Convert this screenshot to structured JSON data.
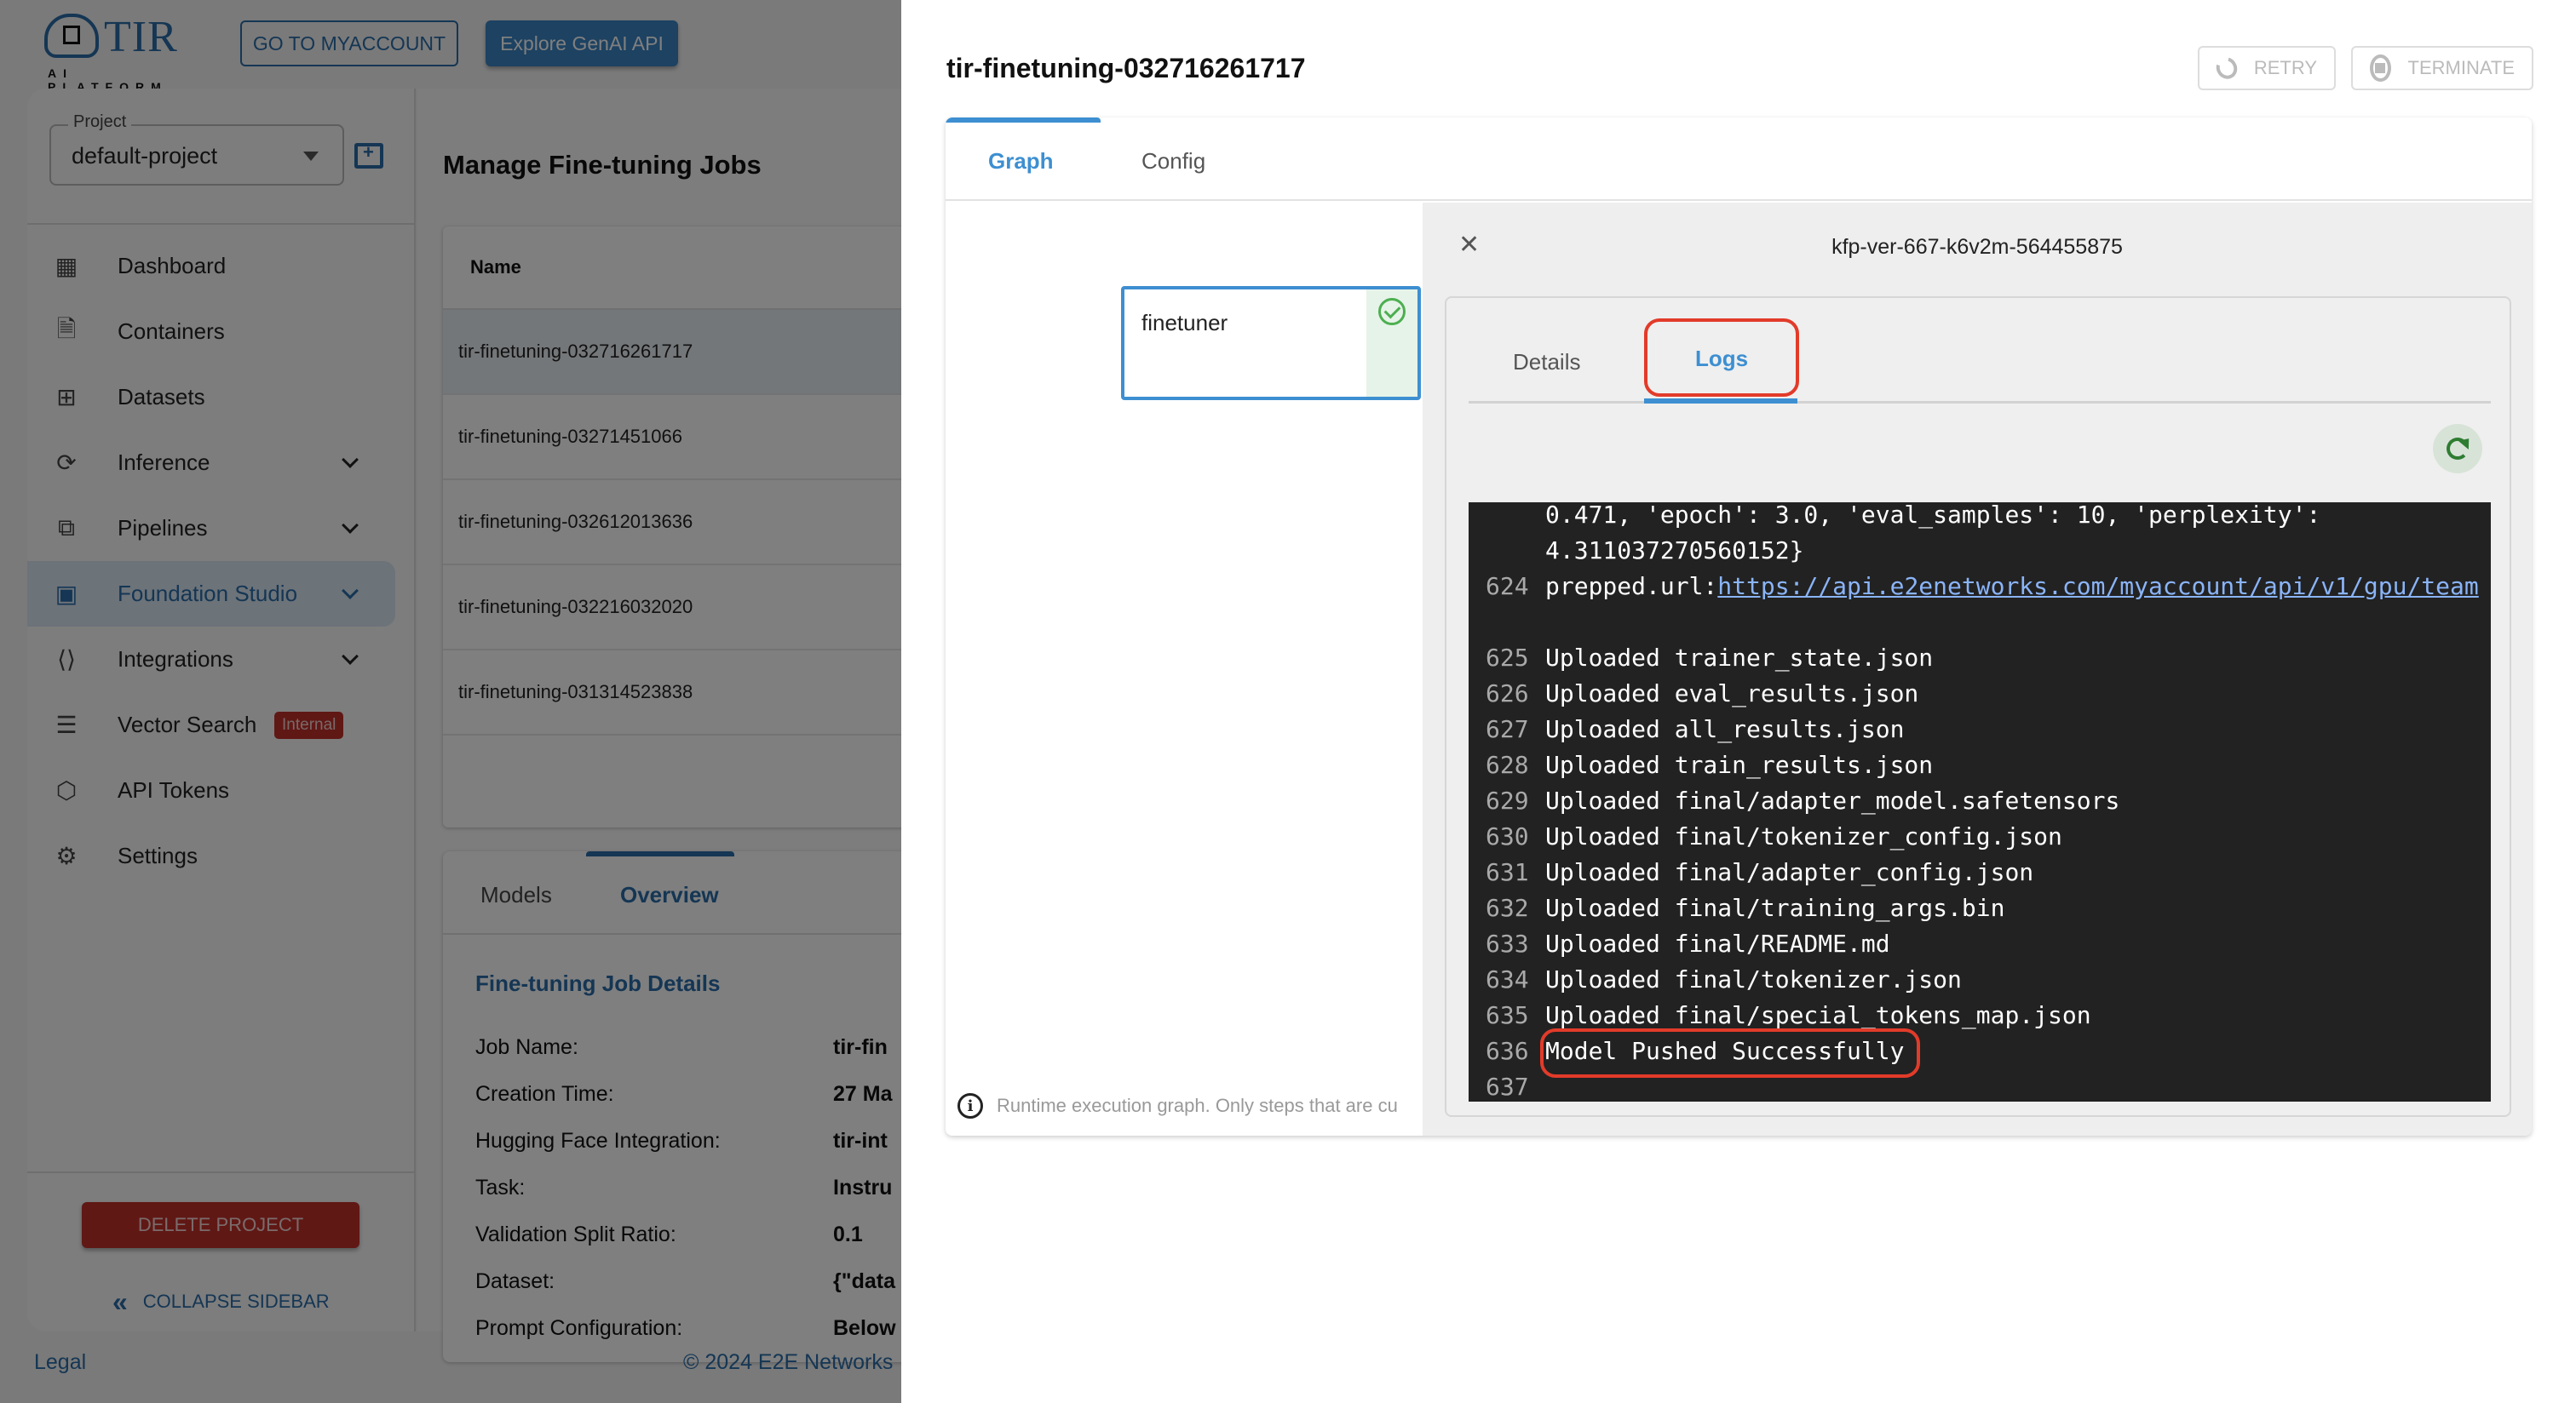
{
  "topbar": {
    "logo_text": "TIR",
    "logo_subtext": "AI PLATFORM",
    "myaccount_button": "GO TO MYACCOUNT",
    "genai_button": "Explore GenAI API"
  },
  "sidebar": {
    "project_label": "Project",
    "project_value": "default-project",
    "items": [
      {
        "label": "Dashboard",
        "icon": "dashboard-icon",
        "expandable": false
      },
      {
        "label": "Containers",
        "icon": "document-icon",
        "expandable": false
      },
      {
        "label": "Datasets",
        "icon": "grid-icon",
        "expandable": false
      },
      {
        "label": "Inference",
        "icon": "inference-icon",
        "expandable": true
      },
      {
        "label": "Pipelines",
        "icon": "pipeline-icon",
        "expandable": true
      },
      {
        "label": "Foundation Studio",
        "icon": "foundation-studio-icon",
        "expandable": true,
        "active": true
      },
      {
        "label": "Integrations",
        "icon": "integrations-icon",
        "expandable": true
      },
      {
        "label": "Vector Search",
        "icon": "vector-search-icon",
        "expandable": false,
        "badge": "Internal"
      },
      {
        "label": "API Tokens",
        "icon": "token-icon",
        "expandable": false
      },
      {
        "label": "Settings",
        "icon": "gear-icon",
        "expandable": false
      }
    ],
    "delete_project": "DELETE PROJECT",
    "collapse_sidebar": "COLLAPSE SIDEBAR"
  },
  "main": {
    "title": "Manage Fine-tuning Jobs",
    "table": {
      "columns": [
        "Name"
      ],
      "rows": [
        "tir-finetuning-032716261717",
        "tir-finetuning-03271451066",
        "tir-finetuning-032612013636",
        "tir-finetuning-032216032020",
        "tir-finetuning-031314523838"
      ]
    },
    "detail_tabs": [
      "Models",
      "Overview"
    ],
    "detail_heading": "Fine-tuning Job Details",
    "details": [
      {
        "label": "Job Name:",
        "value": "tir-fin"
      },
      {
        "label": "Creation Time:",
        "value": "27 Ma"
      },
      {
        "label": "Hugging Face Integration:",
        "value": "tir-int"
      },
      {
        "label": "Task:",
        "value": "Instru"
      },
      {
        "label": "Validation Split Ratio:",
        "value": "0.1"
      },
      {
        "label": "Dataset:",
        "value": "{\"data"
      },
      {
        "label": "Prompt Configuration:",
        "value": "Below"
      }
    ]
  },
  "footer": {
    "legal": "Legal",
    "copyright": "© 2024 E2E Networks"
  },
  "drawer": {
    "title": "tir-finetuning-032716261717",
    "retry": "RETRY",
    "terminate": "TERMINATE",
    "tabs": [
      "Graph",
      "Config"
    ],
    "graph": {
      "node_name": "finetuner",
      "node_status": "succeeded",
      "note": "Runtime execution graph. Only steps that are cu"
    },
    "panel": {
      "title": "kfp-ver-667-k6v2m-564455875",
      "tabs": [
        "Details",
        "Logs"
      ],
      "log_lines": [
        {
          "n": "",
          "text": "0.471, 'epoch': 3.0, 'eval_samples': 10, 'perplexity':"
        },
        {
          "n": "",
          "text": "4.311037270560152}"
        },
        {
          "n": "624",
          "text": "prepped.url:",
          "link": "https://api.e2enetworks.com/myaccount/api/v1/gpu/team"
        },
        {
          "n": "",
          "text": ""
        },
        {
          "n": "625",
          "text": "Uploaded trainer_state.json"
        },
        {
          "n": "626",
          "text": "Uploaded eval_results.json"
        },
        {
          "n": "627",
          "text": "Uploaded all_results.json"
        },
        {
          "n": "628",
          "text": "Uploaded train_results.json"
        },
        {
          "n": "629",
          "text": "Uploaded final/adapter_model.safetensors"
        },
        {
          "n": "630",
          "text": "Uploaded final/tokenizer_config.json"
        },
        {
          "n": "631",
          "text": "Uploaded final/adapter_config.json"
        },
        {
          "n": "632",
          "text": "Uploaded final/training_args.bin"
        },
        {
          "n": "633",
          "text": "Uploaded final/README.md"
        },
        {
          "n": "634",
          "text": "Uploaded final/tokenizer.json"
        },
        {
          "n": "635",
          "text": "Uploaded final/special_tokens_map.json"
        },
        {
          "n": "636",
          "text": "Model Pushed Successfully"
        },
        {
          "n": "637",
          "text": ""
        }
      ]
    }
  },
  "colors": {
    "brand": "#2a6ca8",
    "accent": "#3d8fd1",
    "danger": "#c0302b",
    "success": "#4caf50",
    "annotation": "#e23b2a"
  }
}
